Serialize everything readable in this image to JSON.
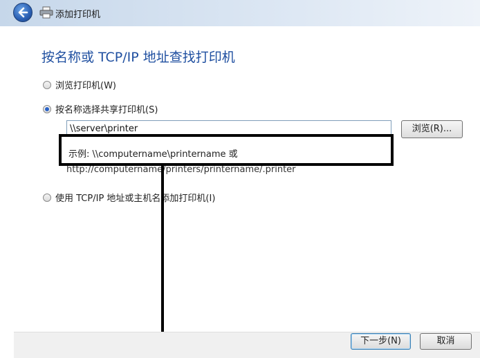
{
  "window": {
    "title": "添加打印机"
  },
  "heading": "按名称或 TCP/IP 地址查找打印机",
  "options": [
    {
      "label": "浏览打印机(W)",
      "selected": false
    },
    {
      "label": "按名称选择共享打印机(S)",
      "selected": true
    },
    {
      "label": "使用 TCP/IP 地址或主机名添加打印机(I)",
      "selected": false
    }
  ],
  "share_input": {
    "value": "\\\\server\\printer"
  },
  "browse_label": "浏览(R)...",
  "example_line1": "示例: \\\\computername\\printername 或",
  "example_line2": "http://computername/printers/printername/.printer",
  "footer": {
    "next_label": "下一步(N)",
    "cancel_label": "取消"
  }
}
